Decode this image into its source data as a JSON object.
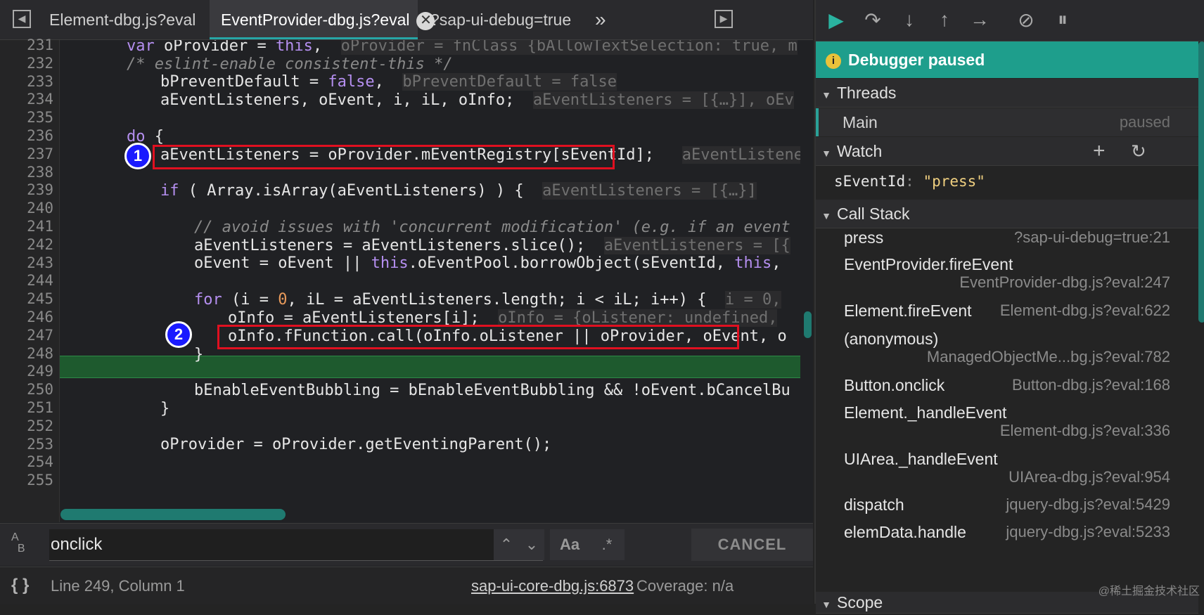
{
  "tabs": [
    {
      "label": "Element-dbg.js?eval",
      "active": false
    },
    {
      "label": "EventProvider-dbg.js?eval",
      "active": true
    },
    {
      "label": "?sap-ui-debug=true",
      "active": false
    }
  ],
  "tab_close_glyph": "✕",
  "more_tabs_glyph": "»",
  "code_lines": [
    {
      "n": "231"
    },
    {
      "n": "232"
    },
    {
      "n": "233"
    },
    {
      "n": "234"
    },
    {
      "n": "235"
    },
    {
      "n": "236"
    },
    {
      "n": "237"
    },
    {
      "n": "238"
    },
    {
      "n": "239"
    },
    {
      "n": "240"
    },
    {
      "n": "241"
    },
    {
      "n": "242"
    },
    {
      "n": "243"
    },
    {
      "n": "244"
    },
    {
      "n": "245"
    },
    {
      "n": "246"
    },
    {
      "n": "247"
    },
    {
      "n": "248"
    },
    {
      "n": "249"
    },
    {
      "n": "250"
    },
    {
      "n": "251"
    },
    {
      "n": "252"
    },
    {
      "n": "253"
    },
    {
      "n": "254"
    },
    {
      "n": "255"
    }
  ],
  "code": {
    "l231a": "var",
    "l231b": " oProvider = ",
    "l231c": "this",
    "l231d": ",",
    "l231i": "oProvider = fnClass {bAllowTextSelection: true, m",
    "l232": "/* eslint-enable consistent-this */",
    "l233a": "bPreventDefault = ",
    "l233b": "false",
    "l233c": ",",
    "l233i": "bPreventDefault = false",
    "l234a": "aEventListeners, oEvent, i, iL, oInfo;",
    "l234i": "aEventListeners = [{…}], oEv",
    "l236a": "do",
    "l236b": " {",
    "l237a": "aEventListeners = oProvider.mEventRegistry[sEventId];",
    "l237i": "aEventListene",
    "l239a": "if",
    "l239b": " ( Array.isArray(aEventListeners) ) {",
    "l239i": "aEventListeners = [{…}]",
    "l241": "// avoid issues with 'concurrent modification' (e.g. if an event",
    "l242a": "aEventListeners = aEventListeners.slice();",
    "l242i": "aEventListeners = [{",
    "l243a": "oEvent = oEvent || ",
    "l243b": "this",
    "l243c": ".oEventPool.borrowObject(sEventId, ",
    "l243d": "this",
    "l243e": ",",
    "l245a": "for",
    "l245b": " (i = ",
    "l245c": "0",
    "l245d": ", iL = aEventListeners.length; i < iL; i++) {",
    "l245i": "i = 0,",
    "l246a": "oInfo = aEventListeners[i];",
    "l246i": "oInfo = {oListener: undefined,",
    "l247a": "oInfo.fFunction.call(oInfo.oListener || oProvider, oEvent, o",
    "l248": "}",
    "l250": "bEnableEventBubbling = bEnableEventBubbling && !oEvent.bCancelBu",
    "l251": "}",
    "l253": "oProvider = oProvider.getEventingParent();"
  },
  "markers": {
    "one": "1",
    "two": "2"
  },
  "search": {
    "value": "onclick",
    "match_case": "Aa",
    "regex": ".*",
    "cancel": "CANCEL"
  },
  "status": {
    "position": "Line 249, Column 1",
    "source_link": "sap-ui-core-dbg.js:6873",
    "coverage": "Coverage: n/a",
    "format_glyph": "{ }"
  },
  "debugger": {
    "banner": "Debugger paused",
    "threads_header": "Threads",
    "thread": {
      "name": "Main",
      "state": "paused"
    },
    "watch_header": "Watch",
    "watch": {
      "name": "sEventId",
      "sep": ": ",
      "value": "\"press\""
    },
    "callstack_header": "Call Stack",
    "frames": [
      {
        "fn": "press",
        "loc": "?sap-ui-debug=true:21"
      },
      {
        "fn": "EventProvider.fireEvent",
        "loc": "EventProvider-dbg.js?eval:247"
      },
      {
        "fn": "Element.fireEvent",
        "loc": "Element-dbg.js?eval:622"
      },
      {
        "fn": "(anonymous)",
        "loc": "ManagedObjectMe...bg.js?eval:782"
      },
      {
        "fn": "Button.onclick",
        "loc": "Button-dbg.js?eval:168"
      },
      {
        "fn": "Element._handleEvent",
        "loc": "Element-dbg.js?eval:336"
      },
      {
        "fn": "UIArea._handleEvent",
        "loc": "UIArea-dbg.js?eval:954"
      },
      {
        "fn": "dispatch",
        "loc": "jquery-dbg.js?eval:5429"
      },
      {
        "fn": "elemData.handle",
        "loc": "jquery-dbg.js?eval:5233"
      }
    ],
    "scope_header": "Scope"
  },
  "watermark": "@稀土掘金技术社区",
  "colors": {
    "accent": "#1e9e8c",
    "highlight_box": "#e01020",
    "exec_line": "#1e5a2e",
    "marker": "#1a1aff"
  }
}
